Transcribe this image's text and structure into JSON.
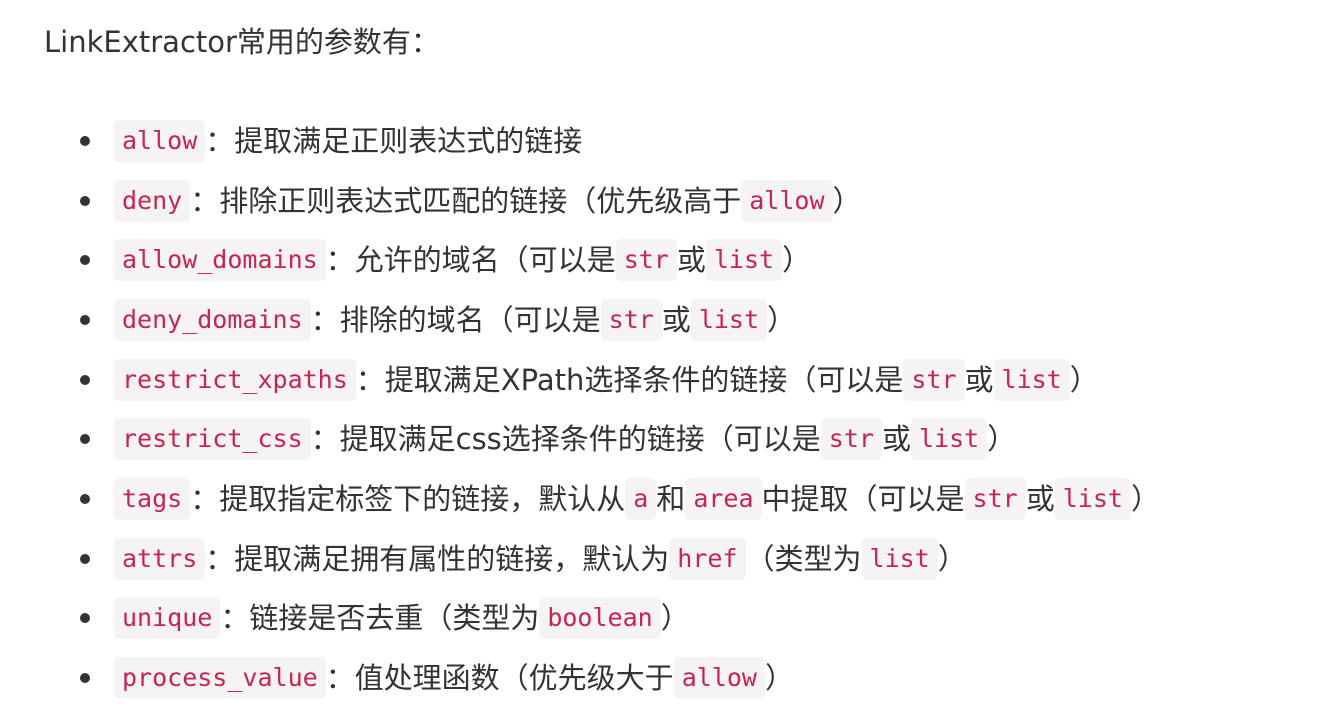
{
  "intro": "LinkExtractor常用的参数有：",
  "colors": {
    "code_text": "#c7254e",
    "code_bg": "#f6f3f4",
    "text": "#333333"
  },
  "items": [
    {
      "parts": [
        "allow",
        "：提取满足正则表达式的链接"
      ]
    },
    {
      "parts": [
        "deny",
        "：排除正则表达式匹配的链接（优先级高于",
        "allow",
        "）"
      ]
    },
    {
      "parts": [
        "allow_domains",
        "：允许的域名（可以是",
        "str",
        "或",
        "list",
        "）"
      ]
    },
    {
      "parts": [
        "deny_domains",
        "：排除的域名（可以是",
        "str",
        "或",
        "list",
        "）"
      ]
    },
    {
      "parts": [
        "restrict_xpaths",
        "：提取满足XPath选择条件的链接（可以是",
        "str",
        "或",
        "list",
        "）"
      ]
    },
    {
      "parts": [
        "restrict_css",
        "：提取满足css选择条件的链接（可以是",
        "str",
        "或",
        "list",
        "）"
      ]
    },
    {
      "parts": [
        "tags",
        "：提取指定标签下的链接，默认从",
        "a",
        "和",
        "area",
        "中提取（可以是",
        "str",
        "或",
        "list",
        "）"
      ]
    },
    {
      "parts": [
        "attrs",
        "：提取满足拥有属性的链接，默认为",
        "href",
        "（类型为",
        "list",
        "）"
      ]
    },
    {
      "parts": [
        "unique",
        "：链接是否去重（类型为",
        "boolean",
        "）"
      ]
    },
    {
      "parts": [
        "process_value",
        "：值处理函数（优先级大于",
        "allow",
        "）"
      ]
    }
  ]
}
